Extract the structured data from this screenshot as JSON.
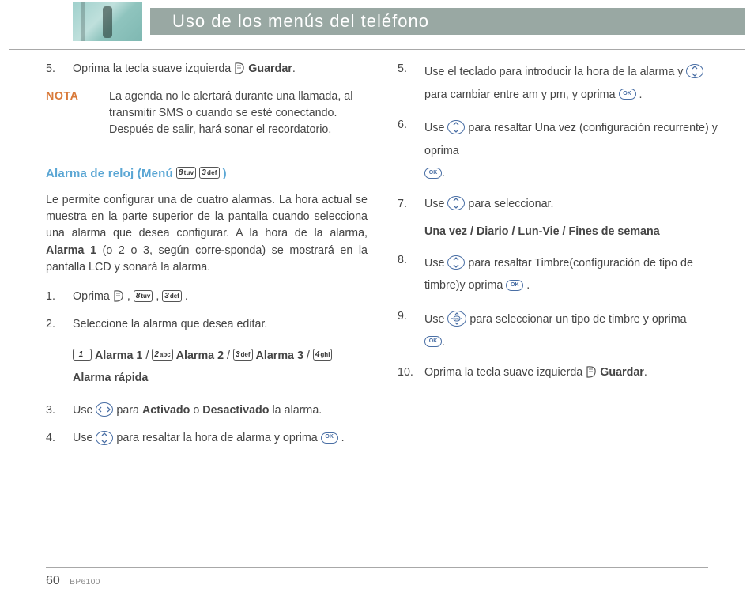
{
  "header": {
    "title": "Uso de los menús del teléfono"
  },
  "left": {
    "step5_a": "Oprima la tecla suave izquierda ",
    "step5_b": "Guardar",
    "nota_label": "NOTA",
    "nota_text": "La agenda no le alertará durante una llamada, al transmitir SMS o cuando se esté conectando. Después de salir, hará sonar el recordatorio.",
    "section_a": "Alarma de reloj (Menú ",
    "section_b": " )",
    "intro_a": "Le permite configurar una de cuatro alarmas. La hora actual se muestra en la parte superior de la pantalla cuando selecciona una alarma que desea configurar. A la hora de la alarma, ",
    "intro_b": "Alarma 1",
    "intro_c": " (o 2 o 3, según corre-sponda) se mostrará en la pantalla LCD y sonará la alarma.",
    "s1": "Oprima ",
    "s2": "Seleccione la alarma que desea editar.",
    "opt1": "Alarma 1",
    "opt2": "Alarma 2",
    "opt3": "Alarma 3",
    "opt4": "Alarma rápida",
    "s3_a": "Use ",
    "s3_b": " para ",
    "s3_c": "Activado",
    "s3_d": " o ",
    "s3_e": "Desactivado",
    "s3_f": " la alarma.",
    "s4_a": "Use ",
    "s4_b": " para resaltar la hora de alarma y oprima ",
    "s4_c": " ."
  },
  "right": {
    "s5_a": "Use el teclado para introducir la hora de la alarma y ",
    "s5_b": " para cambiar entre am y pm, y oprima ",
    "s5_c": " .",
    "s6_a": "Use ",
    "s6_b": " para resaltar Una vez (configuración recurrente) y oprima",
    "s7_a": "Use ",
    "s7_b": " para seleccionar.",
    "s7_bold": "Una vez / Diario / Lun-Vie / Fines de semana",
    "s8_a": "Use ",
    "s8_b": " para resaltar Timbre(configuración de tipo de timbre)y oprima ",
    "s8_c": " .",
    "s9_a": "Use ",
    "s9_b": " para seleccionar un tipo de timbre y oprima",
    "s10_a": "Oprima la tecla suave izquierda ",
    "s10_b": "Guardar",
    "s10_c": "."
  },
  "keys": {
    "k8": {
      "d": "8",
      "l": "tuv"
    },
    "k3": {
      "d": "3",
      "l": "def"
    },
    "k1": {
      "d": "1",
      "l": ""
    },
    "k2": {
      "d": "2",
      "l": "abc"
    },
    "k4": {
      "d": "4",
      "l": "ghi"
    }
  },
  "footer": {
    "page": "60",
    "model": "BP6100"
  }
}
